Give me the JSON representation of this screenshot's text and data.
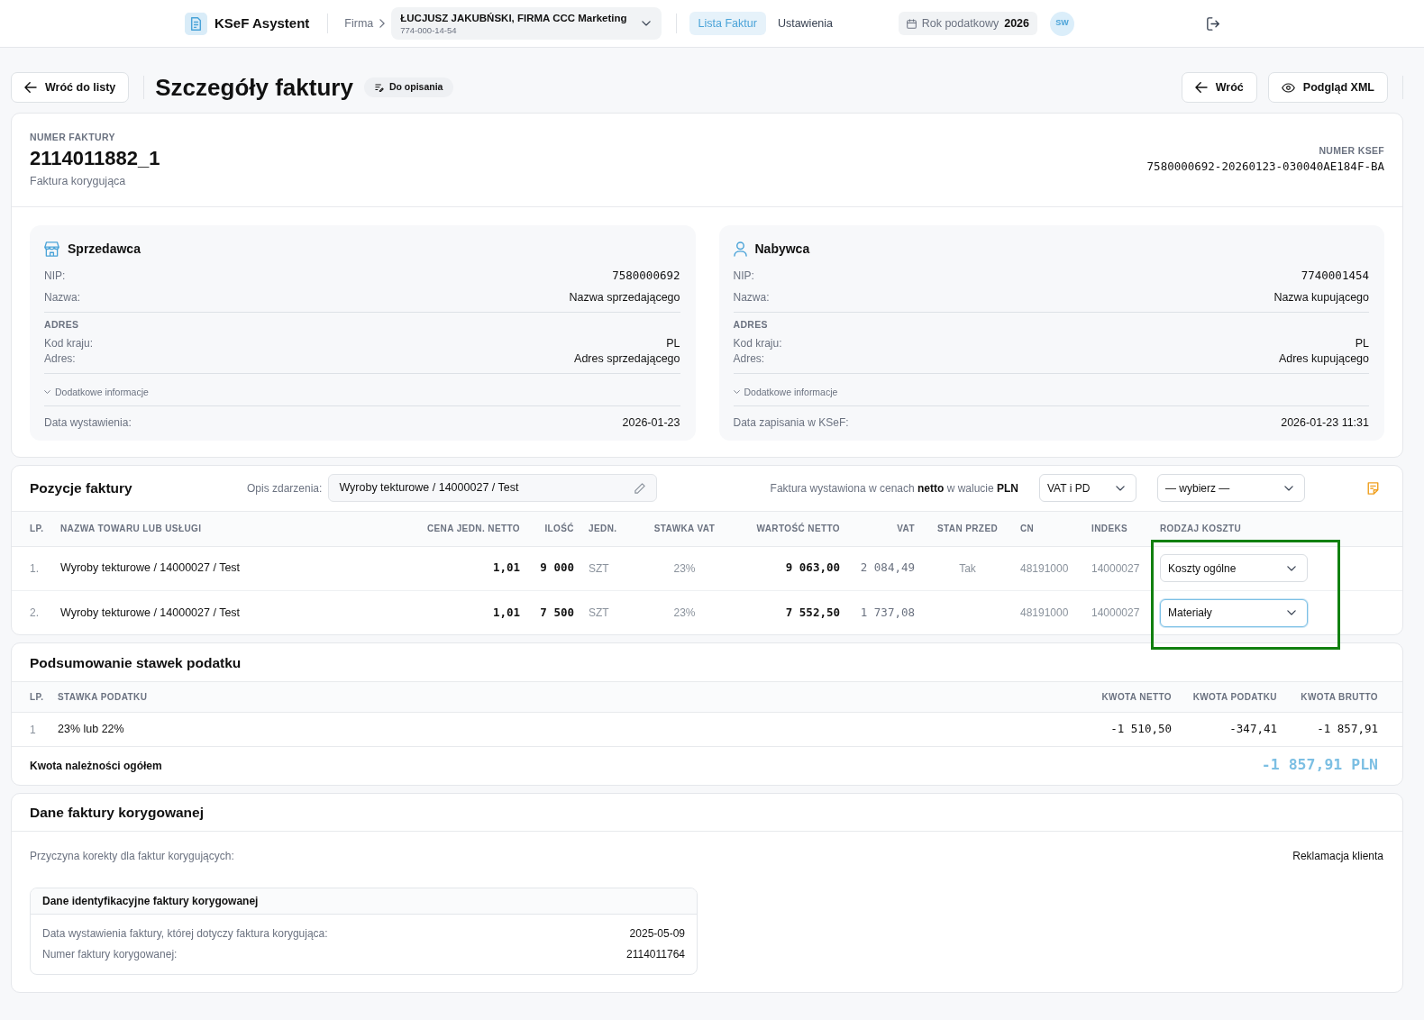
{
  "navbar": {
    "brand": "KSeF Asystent",
    "company_label": "Firma",
    "company": {
      "name": "ŁUCJUSZ JAKUBŃSKI, FIRMA CCC Marketing",
      "nip": "774-000-14-54"
    },
    "links": [
      {
        "label": "Lista Faktur",
        "selected": true
      },
      {
        "label": "Ustawienia",
        "selected": false
      }
    ],
    "tax_year": {
      "label": "Rok podatkowy",
      "value": "2026"
    },
    "avatar": "SW"
  },
  "page_header": {
    "back_label": "Wróć do listy",
    "title": "Szczegóły faktury",
    "status": "Do opisania",
    "actions": [
      {
        "kind": "back",
        "label": "Wróć"
      },
      {
        "kind": "preview",
        "label": "Podgląd XML"
      }
    ]
  },
  "invoice": {
    "number_label": "NUMER FAKTURY",
    "number": "2114011882_1",
    "type": "Faktura korygująca",
    "ksef_label": "NUMER KSEF",
    "ksef_number": "7580000692-20260123-030040AE184F-BA"
  },
  "parties": [
    {
      "kind": "seller",
      "title": "Sprzedawca",
      "fields": [
        {
          "kind": "number",
          "label": "NIP:",
          "value": "7580000692"
        },
        {
          "kind": "text",
          "label": "Nazwa:",
          "value": "Nazwa sprzedającego"
        }
      ],
      "address_label": "ADRES",
      "address_fields": [
        {
          "label": "Kod kraju:",
          "value": "PL"
        },
        {
          "label": "Adres:",
          "value": "Adres sprzedającego"
        }
      ],
      "more_label": "Dodatkowe informacje",
      "date": {
        "label": "Data wystawienia:",
        "value": "2026-01-23"
      }
    },
    {
      "kind": "buyer",
      "title": "Nabywca",
      "fields": [
        {
          "kind": "number",
          "label": "NIP:",
          "value": "7740001454"
        },
        {
          "kind": "text",
          "label": "Nazwa:",
          "value": "Nazwa kupującego"
        }
      ],
      "address_label": "ADRES",
      "address_fields": [
        {
          "label": "Kod kraju:",
          "value": "PL"
        },
        {
          "label": "Adres:",
          "value": "Adres kupującego"
        }
      ],
      "more_label": "Dodatkowe informacje",
      "date": {
        "label": "Data zapisania w KSeF:",
        "value": "2026-01-23 11:31"
      }
    }
  ],
  "positions": {
    "title": "Pozycje faktury",
    "event_label": "Opis zdarzenia:",
    "event_value": "Wyroby tekturowe / 14000027 / Test",
    "price_note": "Faktura wystawiona w cenach **netto** w walucie **PLN**",
    "filters": [
      {
        "value": "VAT i PD"
      },
      {
        "value": "— wybierz —"
      }
    ],
    "columns": [
      "LP.",
      "NAZWA TOWARU LUB USŁUGI",
      "CENA JEDN. NETTO",
      "ILOŚĆ",
      "JEDN.",
      "STAWKA VAT",
      "WARTOŚĆ NETTO",
      "VAT",
      "STAN PRZED",
      "CN",
      "INDEKS",
      "RODZAJ KOSZTU"
    ],
    "rows": [
      {
        "lp": "1.",
        "name": "Wyroby tekturowe / 14000027 / Test",
        "unit_price": "1,01",
        "quantity": "9 000",
        "unit": "SZT",
        "vat_rate": "23%",
        "net_value": "9 063,00",
        "vat": "2 084,49",
        "state_before": "Tak",
        "cn": "48191000",
        "index": "14000027",
        "cost_type": {
          "value": "Koszty ogólne",
          "focused": false
        }
      },
      {
        "lp": "2.",
        "name": "Wyroby tekturowe / 14000027 / Test",
        "unit_price": "1,01",
        "quantity": "7 500",
        "unit": "SZT",
        "vat_rate": "23%",
        "net_value": "7 552,50",
        "vat": "1 737,08",
        "cn": "48191000",
        "index": "14000027",
        "cost_type": {
          "value": "Materiały",
          "focused": true
        }
      }
    ]
  },
  "highlight": {
    "kind": "frame"
  },
  "tax_summary": {
    "title": "Podsumowanie stawek podatku",
    "columns": [
      "LP.",
      "STAWKA PODATKU",
      "KWOTA NETTO",
      "KWOTA PODATKU",
      "KWOTA BRUTTO"
    ],
    "rows": [
      {
        "lp": "1",
        "rate": "23% lub 22%",
        "net": "-1 510,50",
        "tax": "-347,41",
        "gross": "-1 857,91"
      }
    ],
    "total_label": "Kwota należności ogółem",
    "total_value": "-1 857,91 PLN"
  },
  "corrected_invoice": {
    "title": "Dane faktury korygowanej",
    "reason_label": "Przyczyna korekty dla faktur korygujących:",
    "reason_value": "Reklamacja klienta",
    "id_box": {
      "title": "Dane identyfikacyjne faktury korygowanej",
      "fields": [
        {
          "label": "Data wystawienia faktury, której dotyczy faktura korygująca:",
          "value": "2025-05-09"
        },
        {
          "label": "Numer faktury korygowanej:",
          "value": "2114011764"
        }
      ]
    }
  }
}
